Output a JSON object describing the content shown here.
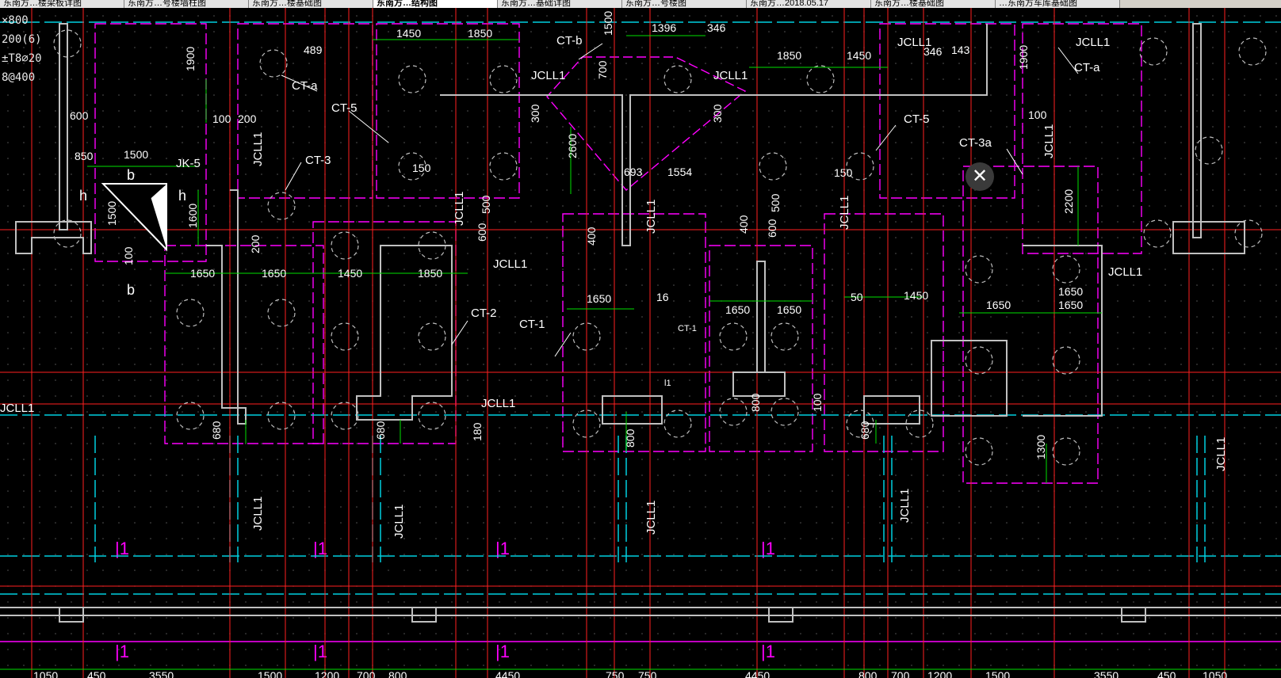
{
  "tabs": [
    {
      "label": "东南方…楼梁板详图",
      "active": false
    },
    {
      "label": "东南方…号楼墙柱图",
      "active": false
    },
    {
      "label": "东南方…楼基础图",
      "active": false
    },
    {
      "label": "东南方…结构图",
      "active": true
    },
    {
      "label": "东南方…基础详图",
      "active": false
    },
    {
      "label": "东南方…号楼图",
      "active": false
    },
    {
      "label": "东南方…2018.05.17",
      "active": false
    },
    {
      "label": "东南方…楼基础图",
      "active": false
    },
    {
      "label": "…东南方车库基础图",
      "active": false
    }
  ],
  "close_button": {
    "glyph": "✕"
  },
  "notes": [
    "×800",
    "200(6)",
    "±T8⌀20",
    "8@400"
  ],
  "labels": {
    "ct_a_left": "CT-a",
    "ct_a_right": "CT-a",
    "ct_b": "CT-b",
    "ct_5_left": "CT-5",
    "ct_5_right": "CT-5",
    "ct_3": "CT-3",
    "ct_3a": "CT-3a",
    "ct_2": "CT-2",
    "ct_1": "CT-1",
    "ct_1_small": "CT-1",
    "jk_5": "JK-5",
    "jcll1": "JCLL1",
    "beam": "l1",
    "b": "b",
    "h": "h"
  },
  "dimensions": {
    "top": [
      "1450",
      "1850",
      "1396",
      "346",
      "1850",
      "1450",
      "346",
      "143",
      "489",
      "1900",
      "1900",
      "1500",
      "2600",
      "700",
      "300",
      "300"
    ],
    "left": [
      "600",
      "850",
      "1500",
      "100",
      "200",
      "1500",
      "1600",
      "100",
      "200"
    ],
    "middle": [
      "1650",
      "1650",
      "1450",
      "1850",
      "150",
      "150",
      "693",
      "1554",
      "600",
      "500",
      "600",
      "500",
      "400",
      "400",
      "1650",
      "1650",
      "1650",
      "1650",
      "1450",
      "1650",
      "1650",
      "2200",
      "100",
      "50",
      "16"
    ],
    "lower": [
      "680",
      "680",
      "180",
      "800",
      "800",
      "100",
      "680",
      "1300"
    ],
    "bottom": [
      "1050",
      "450",
      "3550",
      "1500",
      "1200",
      "700",
      "800",
      "4450",
      "750",
      "750",
      "4450",
      "800",
      "700",
      "1200",
      "1500",
      "3550",
      "450",
      "1050"
    ]
  },
  "colors": {
    "background": "#000000",
    "axis": "#ff2020",
    "dim": "#00e000",
    "pile": "#ff00ff",
    "beam": "#00d0e0",
    "wall": "#c0c0c0",
    "text": "#ffffff"
  }
}
